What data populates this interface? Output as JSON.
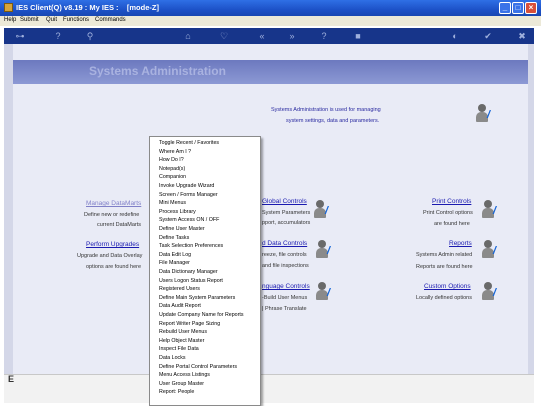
{
  "window": {
    "title": "IES Client(Q) v8.19 : My IES :    [mode-Z]"
  },
  "menubar": {
    "items": [
      "Help",
      "Submit",
      "Quit",
      "Functions",
      "Commands"
    ]
  },
  "banner": {
    "title": "Systems Administration"
  },
  "intro": {
    "line1": "Systems Administration is used for managing",
    "line2": "system settings, data and parameters."
  },
  "left": {
    "manage": {
      "link": "Manage DataMarts",
      "line1": "Define new or redefine",
      "line2": "current DataMarts"
    },
    "upgrades": {
      "link": "Perform Upgrades",
      "line1": "Upgrade and Data Overlay",
      "line2": "options are found here"
    }
  },
  "middle": {
    "global": {
      "link": "Global Controls",
      "line1": "System Parameters",
      "line2": "pport, accumulators"
    },
    "data": {
      "link": "d Data Controls",
      "line1": "reeze, file controls",
      "line2": "and file inspections"
    },
    "language": {
      "link": "nguage Controls",
      "line1": "-Build User Menus",
      "line2": "| Phrase Translate"
    }
  },
  "right": {
    "print": {
      "link": "Print Controls",
      "line1": "Print Control options",
      "line2": "are found here"
    },
    "reports": {
      "link": "Reports",
      "line1": "Systems Admin related",
      "line2": "Reports are found here"
    },
    "custom": {
      "link": "Custom Options",
      "line1": "Locally defined options"
    }
  },
  "popup": {
    "items": [
      "Toggle Recent / Favorites",
      "Where Am I ?",
      "How Do I?",
      "Notepad(s)",
      "Companion",
      "Invoke Upgrade Wizard",
      "Screen / Forms Manager",
      "Mini Menus",
      "Process Library",
      "System Access ON / OFF",
      "Define User Master",
      "Define Tasks",
      "Task Selection Preferences",
      "Data Edit Log",
      "File Manager",
      "Data Dictionary Manager",
      "Users Logon Status Report",
      "Registered Users",
      "Define Main System Parameters",
      "Data Audit Report",
      "Update Company Name for Reports",
      "Report Writer Page Sizing",
      "Rebuild User Menus",
      "Help Object Master",
      "Inspect File Data",
      "Data Locks",
      "Define Portal Control Parameters",
      "Menu Access Listings",
      "User Group Master",
      "Report: People"
    ]
  },
  "colors": {
    "titlebar": "#1d52c8",
    "toolbar": "#17358a",
    "banner": "#7a87c8",
    "link": "#1a1ab0",
    "panel": "#e9ebf6"
  },
  "icons": [
    "key-icon",
    "help-icon",
    "search-icon",
    "home-icon",
    "heart-icon",
    "refresh-icon",
    "back-icon",
    "forward-icon",
    "question-icon",
    "stop-icon",
    "globe-icon",
    "check-icon",
    "close-icon"
  ]
}
